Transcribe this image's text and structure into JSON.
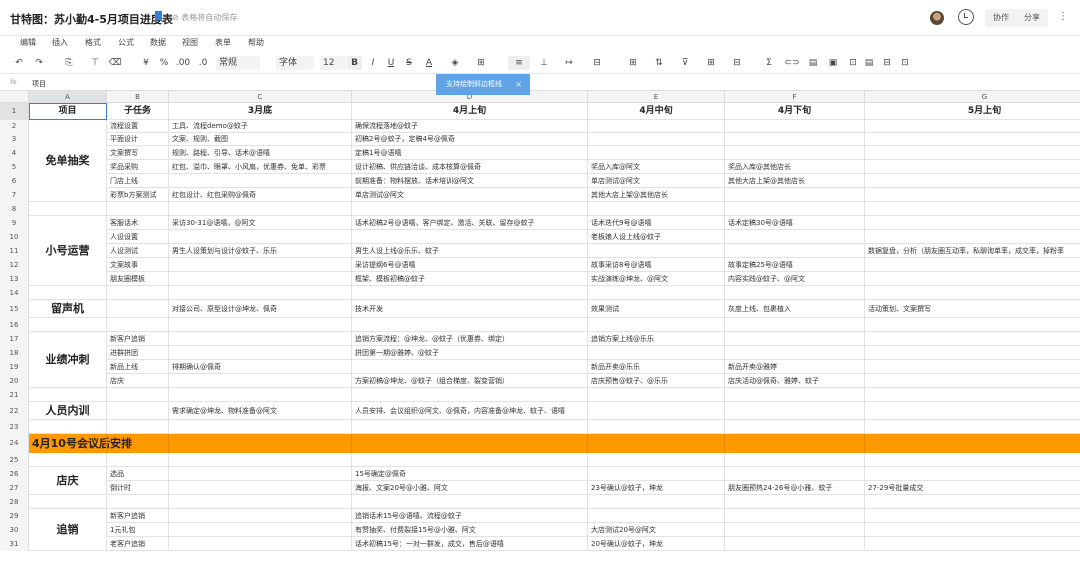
{
  "header": {
    "title": "甘特图：苏小勤4-5月项目进度表",
    "save_status": "⊘ 表格将自动保存",
    "collab_label": "协作",
    "share_label": "分享",
    "more_label": "⋮"
  },
  "menu": [
    "编辑",
    "插入",
    "格式",
    "公式",
    "数据",
    "视图",
    "表单",
    "帮助"
  ],
  "toolbar": {
    "undo": "↶",
    "redo": "↷",
    "paint": "⎘",
    "format_brush": "⊤",
    "clear": "⌫",
    "currency": "¥",
    "percent": "%",
    "dec_more": ".00",
    "dec_less": ".0",
    "number_format": "常规",
    "font_family": "字体",
    "font_size": "12",
    "bold": "B",
    "italic": "I",
    "underline": "U",
    "strike": "S",
    "text_color": "A",
    "fill_color": "◈",
    "borders": "⊞",
    "align": "≡",
    "valign": "⊥",
    "wrap": "↦",
    "merge": "⊟",
    "freeze": "⊞",
    "sort": "⇅",
    "filter": "⊽",
    "table": "⊞",
    "cond": "⊟",
    "sum": "Σ",
    "link": "⊂⊃",
    "chart": "▤",
    "image": "▣",
    "comment": "⊡",
    "save": "▤",
    "print": "⊟"
  },
  "tooltip": {
    "text": "支持绘制斜边框线",
    "close": "×"
  },
  "formula_bar": {
    "fx": "fx",
    "content": "项目"
  },
  "columns": [
    "A",
    "B",
    "C",
    "D",
    "E",
    "F",
    "G"
  ],
  "row_numbers": [
    "1",
    "2",
    "3",
    "4",
    "5",
    "6",
    "7",
    "8",
    "9",
    "10",
    "11",
    "12",
    "13",
    "14",
    "15",
    "16",
    "17",
    "18",
    "19",
    "20",
    "21",
    "22",
    "23",
    "24",
    "25",
    "26",
    "27",
    "28",
    "29",
    "30",
    "31"
  ],
  "table_header": [
    "项目",
    "子任务",
    "3月底",
    "4月上旬",
    "4月中旬",
    "4月下旬",
    "5月上旬"
  ],
  "groups": [
    {
      "name": "免单抽奖"
    },
    {
      "name": "小号运营"
    },
    {
      "name": "留声机"
    },
    {
      "name": "业绩冲刺"
    },
    {
      "name": "人员内训"
    },
    {
      "name": "店庆"
    },
    {
      "name": "追销"
    }
  ],
  "band": {
    "text": "4月10号会议后安排"
  },
  "rows": [
    [
      "",
      "流程设置",
      "工具、流程demo@蚊子",
      "确保流程落地@蚊子",
      "",
      "",
      ""
    ],
    [
      "",
      "平面设计",
      "文案、规则、截图",
      "初稿2号@蚊子，定稿4号@佩奇",
      "",
      "",
      ""
    ],
    [
      "",
      "文案撰写",
      "规则、路程、引导、话术@语嘻",
      "定稿1号@语嘻",
      "",
      "",
      ""
    ],
    [
      "",
      "奖品采购",
      "红包、溢巾、眼罩、小风扇，优惠券、免单、彩票",
      "设计初稿、供应链洽谈、成本核算@佩奇",
      "奖品入库@阿文",
      "奖品入库@其他店长",
      ""
    ],
    [
      "",
      "门店上线",
      "",
      "前期准备：物料摆放、话术培训@阿文",
      "单店测试@阿文",
      "其他大店上架@其他店长",
      ""
    ],
    [
      "",
      "彩票b方案测试",
      "红包设计、红包采购@佩奇",
      "单店测试@阿文",
      "其他大店上架@其他店长",
      "",
      ""
    ],
    [
      "",
      "",
      "",
      "",
      "",
      "",
      ""
    ],
    [
      "",
      "客服话术",
      "采访30-31@语嘻，@阿文",
      "话术初稿2号@语嘻，客户绑定、激活、关联、留存@蚊子",
      "话术迭代9号@语嘻",
      "话术定稿30号@语嘻",
      ""
    ],
    [
      "",
      "人设设置",
      "",
      "",
      "老板娘人设上线@蚊子",
      "",
      ""
    ],
    [
      "",
      "人设测试",
      "男生人设策划与设计@蚊子、乐乐",
      "男生人设上线@乐乐、蚊子",
      "",
      "",
      "数据复盘，分析（朋友圈互动率，私聊询单率，成交率，掉粉率"
    ],
    [
      "",
      "文案故事",
      "",
      "采访提纲6号@语嘻",
      "故事采访8号@语嘻",
      "故事定稿25号@语嘻",
      ""
    ],
    [
      "",
      "朋友圈模板",
      "",
      "框架、模板初稿@蚊子",
      "实战演练@坤龙、@阿文",
      "内容实践@蚊子、@阿文",
      ""
    ],
    [
      "",
      "",
      "",
      "",
      "",
      "",
      ""
    ],
    [
      "",
      "",
      "对接公司、原型设计@坤龙、佩奇",
      "技术开发",
      "效果测试",
      "灰度上线、包裹植入",
      "活动策划、文案撰写"
    ],
    [
      "",
      "",
      "",
      "",
      "",
      "",
      ""
    ],
    [
      "",
      "新客户追销",
      "",
      "追销方案流程：@坤龙、@蚊子（优惠券、绑定）",
      "追销方案上线@乐乐",
      "",
      ""
    ],
    [
      "",
      "进群拼团",
      "",
      "拼团第一期@雅婷、@蚊子",
      "",
      "",
      ""
    ],
    [
      "",
      "新品上线",
      "排期确认@佩奇",
      "",
      "新品开卖@乐乐",
      "新品开卖@雅婷",
      ""
    ],
    [
      "",
      "店庆",
      "",
      "方案初稿@坤龙、@蚊子（组合梯度、裂变营销）",
      "店庆预售@蚊子、@乐乐",
      "店庆活动@佩奇、雅婷、蚊子",
      ""
    ],
    [
      "",
      "",
      "",
      "",
      "",
      "",
      ""
    ],
    [
      "",
      "",
      "需求确定@坤龙、物料准备@阿文",
      "人员安排、会议组织@阿文、@佩奇，内容准备@坤龙、蚊子、语嘻",
      "",
      "",
      ""
    ],
    [
      "",
      "",
      "",
      "",
      "",
      "",
      ""
    ],
    [
      "",
      "",
      "",
      "",
      "",
      "",
      ""
    ],
    [
      "",
      "",
      "",
      "",
      "",
      "",
      ""
    ],
    [
      "",
      "选品",
      "",
      "15号确定@佩奇",
      "",
      "",
      ""
    ],
    [
      "",
      "倒计时",
      "",
      "海报、文案20号@小雅、阿文",
      "23号确认@蚊子，坤龙",
      "朋友圈预热24-26号@小雅、蚊子",
      "27-29号批量成交"
    ],
    [
      "",
      "",
      "",
      "",
      "",
      "",
      ""
    ],
    [
      "",
      "新客户追销",
      "",
      "追销话术15号@语嘻、流程@蚊子",
      "",
      "",
      ""
    ],
    [
      "",
      "1元礼包",
      "",
      "有赞抽奖、付费裂接15号@小雅、阿文",
      "大店测试20号@阿文",
      "",
      ""
    ],
    [
      "",
      "老客户追销",
      "",
      "话术初稿15号：一对一群发，成交，售后@语嘻",
      "20号确认@蚊子，坤龙",
      "",
      ""
    ]
  ]
}
